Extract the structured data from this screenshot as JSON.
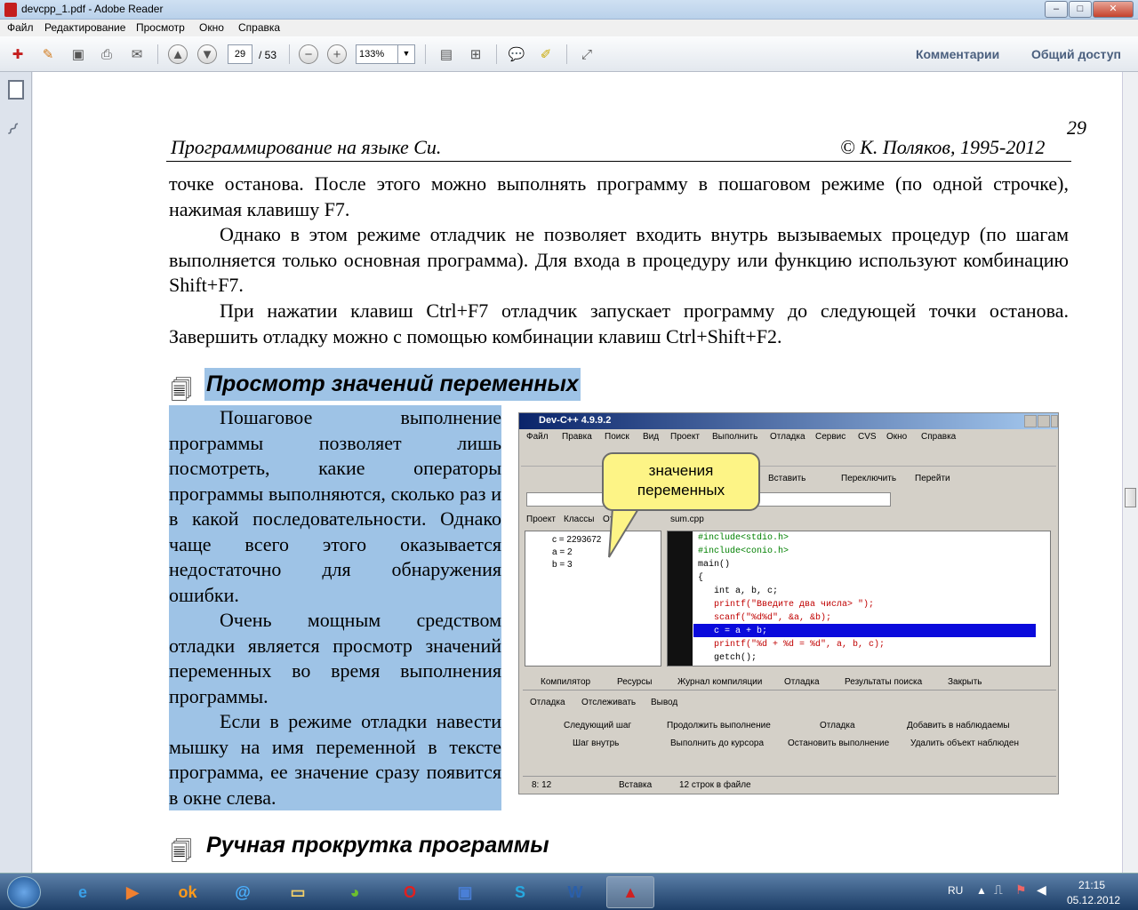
{
  "window": {
    "title": "devcpp_1.pdf - Adobe Reader",
    "menu": [
      "Файл",
      "Редактирование",
      "Просмотр",
      "Окно",
      "Справка"
    ],
    "controls": {
      "minimize": "–",
      "maximize": "□",
      "close": "✕"
    }
  },
  "toolbar": {
    "page_current": "29",
    "page_total": "/ 53",
    "zoom": "133%",
    "comments_label": "Комментарии",
    "share_label": "Общий доступ"
  },
  "document": {
    "page_number": "29",
    "header_left": "Программирование на языке Си.",
    "header_right": "© К. Поляков, 1995-2012",
    "p1": "точке останова. После этого можно выполнять программу в пошаговом режиме (по одной строчке), нажимая клавишу F7.",
    "p2": "Однако в этом режиме отладчик не позволяет входить внутрь вызываемых процедур (по шагам выполняется только основная программа). Для входа в процедуру или функцию используют комбинацию Shift+F7.",
    "p3": "При нажатии клавиш Ctrl+F7 отладчик запускает программу до следующей точки останова. Завершить отладку можно с помощью комбинации клавиш Ctrl+Shift+F2.",
    "heading1": "Просмотр значений переменных",
    "side1": "Пошаговое выполнение программы позволяет лишь посмотреть, какие операторы программы выполняются, сколько раз и в какой последовательности. Однако чаще всего этого оказывается недостаточно для обнаружения ошибки.",
    "side2": "Очень мощным средством отладки является просмотр значений переменных во время выполнения программы.",
    "side3": "Если в режиме отладки навести мышку на имя переменной в тексте программа, ее значение сразу появится в окне слева.",
    "heading2": "Ручная прокрутка программы",
    "callout": "значения переменных"
  },
  "devcpp": {
    "title": "Dev-C++ 4.9.9.2",
    "menu": [
      "Файл",
      "Правка",
      "Поиск",
      "Вид",
      "Проект",
      "Выполнить",
      "Отладка",
      "Сервис",
      "CVS",
      "Окно",
      "Справка"
    ],
    "toolbar_labels": [
      "Вставить",
      "Переключить",
      "Перейти"
    ],
    "left_tabs": [
      "Проект",
      "Классы",
      "Отл"
    ],
    "file_tab": "sum.cpp",
    "vars": [
      "c = 2293672",
      "a = 2",
      "b = 3"
    ],
    "code": [
      "#include<stdio.h>",
      "#include<conio.h>",
      "main()",
      "{",
      "   int a, b, c;",
      "   printf(\"Введите два числа> \");",
      "   scanf(\"%d%d\", &a, &b);",
      "   c = a + b;",
      "   printf(\"%d + %d = %d\", a, b, c);",
      "   getch();"
    ],
    "bottom_tabs": [
      "Компилятор",
      "Ресурсы",
      "Журнал компиляции",
      "Отладка",
      "Результаты поиска",
      "Закрыть"
    ],
    "sub_tabs": [
      "Отладка",
      "Отслеживать",
      "Вывод"
    ],
    "actions": [
      "Следующий шаг",
      "Шаг внутрь",
      "Продолжить выполнение",
      "Выполнить до курсора",
      "Отладка",
      "Остановить выполнение",
      "Добавить в наблюдаемы",
      "Удалить объект наблюден"
    ],
    "status": [
      "8: 12",
      "Вставка",
      "12 строк в файле"
    ]
  },
  "taskbar": {
    "lang": "RU",
    "time": "21:15",
    "date": "05.12.2012"
  }
}
